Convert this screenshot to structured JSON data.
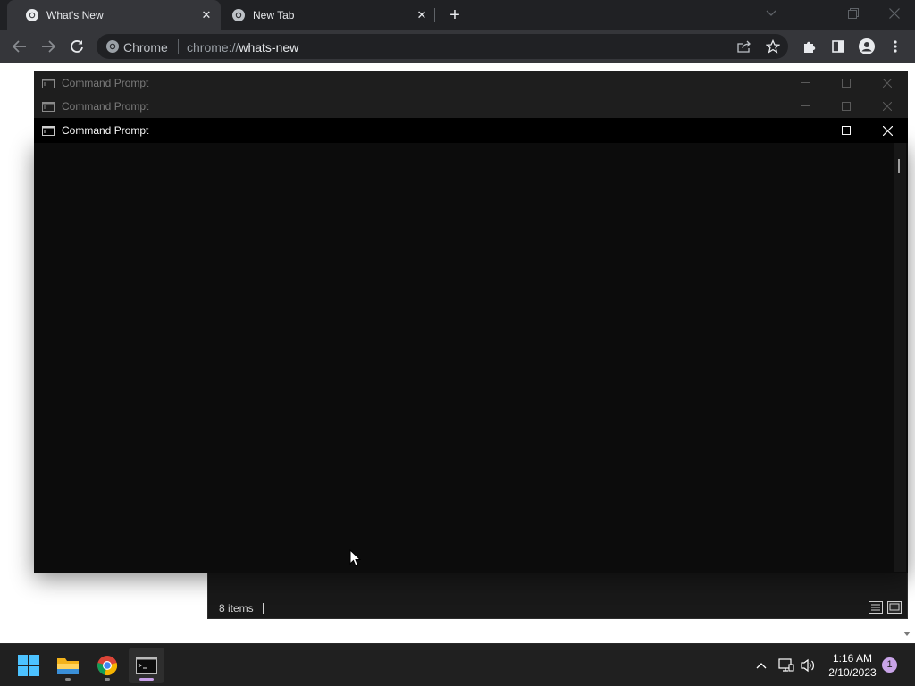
{
  "browser": {
    "tabs": [
      {
        "title": "What's New",
        "active": true
      },
      {
        "title": "New Tab",
        "active": false
      }
    ],
    "omnibox": {
      "site_label": "Chrome",
      "url_scheme": "chrome://",
      "url_path": "whats-new"
    }
  },
  "cmd_windows": [
    {
      "title": "Command Prompt",
      "active": false
    },
    {
      "title": "Command Prompt",
      "active": false
    },
    {
      "title": "Command Prompt",
      "active": true
    }
  ],
  "explorer": {
    "status_text": "8 items"
  },
  "taskbar": {
    "apps": [
      "windows-start",
      "file-explorer",
      "google-chrome",
      "command-prompt"
    ],
    "active_app": "command-prompt",
    "clock_time": "1:16 AM",
    "clock_date": "2/10/2023",
    "notification_count": "1"
  },
  "colors": {
    "chrome_dark": "#202124",
    "chrome_tab": "#35363a",
    "cmd_background": "#0c0c0c",
    "taskbar": "#202020",
    "accent": "#c7a0e8"
  }
}
